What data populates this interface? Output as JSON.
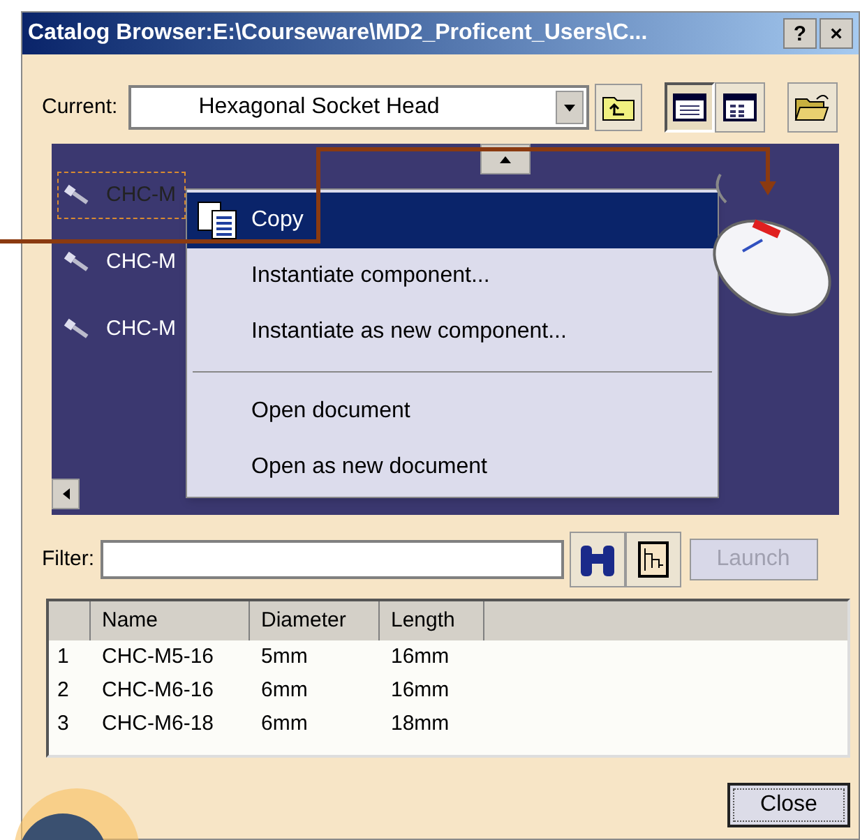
{
  "window": {
    "title": "Catalog Browser:E:\\Courseware\\MD2_Proficent_Users\\C...",
    "buttons": [
      "?",
      "×"
    ]
  },
  "current": {
    "label": "Current:",
    "value": "Hexagonal Socket Head"
  },
  "view_buttons": [
    {
      "selected": true
    },
    {
      "selected": false
    }
  ],
  "preview_items": [
    {
      "name": "CHC-M",
      "selected": true
    },
    {
      "name": "CHC-M",
      "selected": false
    },
    {
      "name": "CHC-M",
      "selected": false
    }
  ],
  "context_menu": [
    {
      "label": "Copy",
      "kind": "icon",
      "selected": true
    },
    {
      "label": "Instantiate component...",
      "kind": "plain",
      "selected": false
    },
    {
      "label": "Instantiate as new component...",
      "kind": "plain",
      "selected": false
    },
    {
      "kind": "separator"
    },
    {
      "label": "Open document",
      "kind": "plain",
      "selected": false
    },
    {
      "label": "Open as new document",
      "kind": "plain",
      "selected": false
    }
  ],
  "filter": {
    "label": "Filter:",
    "launch": "Launch",
    "launch_disabled": true
  },
  "table": {
    "columns": [
      "Name",
      "Diameter",
      "Length"
    ],
    "rows": [
      {
        "index": "1",
        "cells": [
          "CHC-M5-16",
          "5mm",
          "16mm"
        ]
      },
      {
        "index": "2",
        "cells": [
          "CHC-M6-16",
          "6mm",
          "16mm"
        ]
      },
      {
        "index": "3",
        "cells": [
          "CHC-M6-18",
          "6mm",
          "18mm"
        ]
      }
    ]
  },
  "close": "Close"
}
